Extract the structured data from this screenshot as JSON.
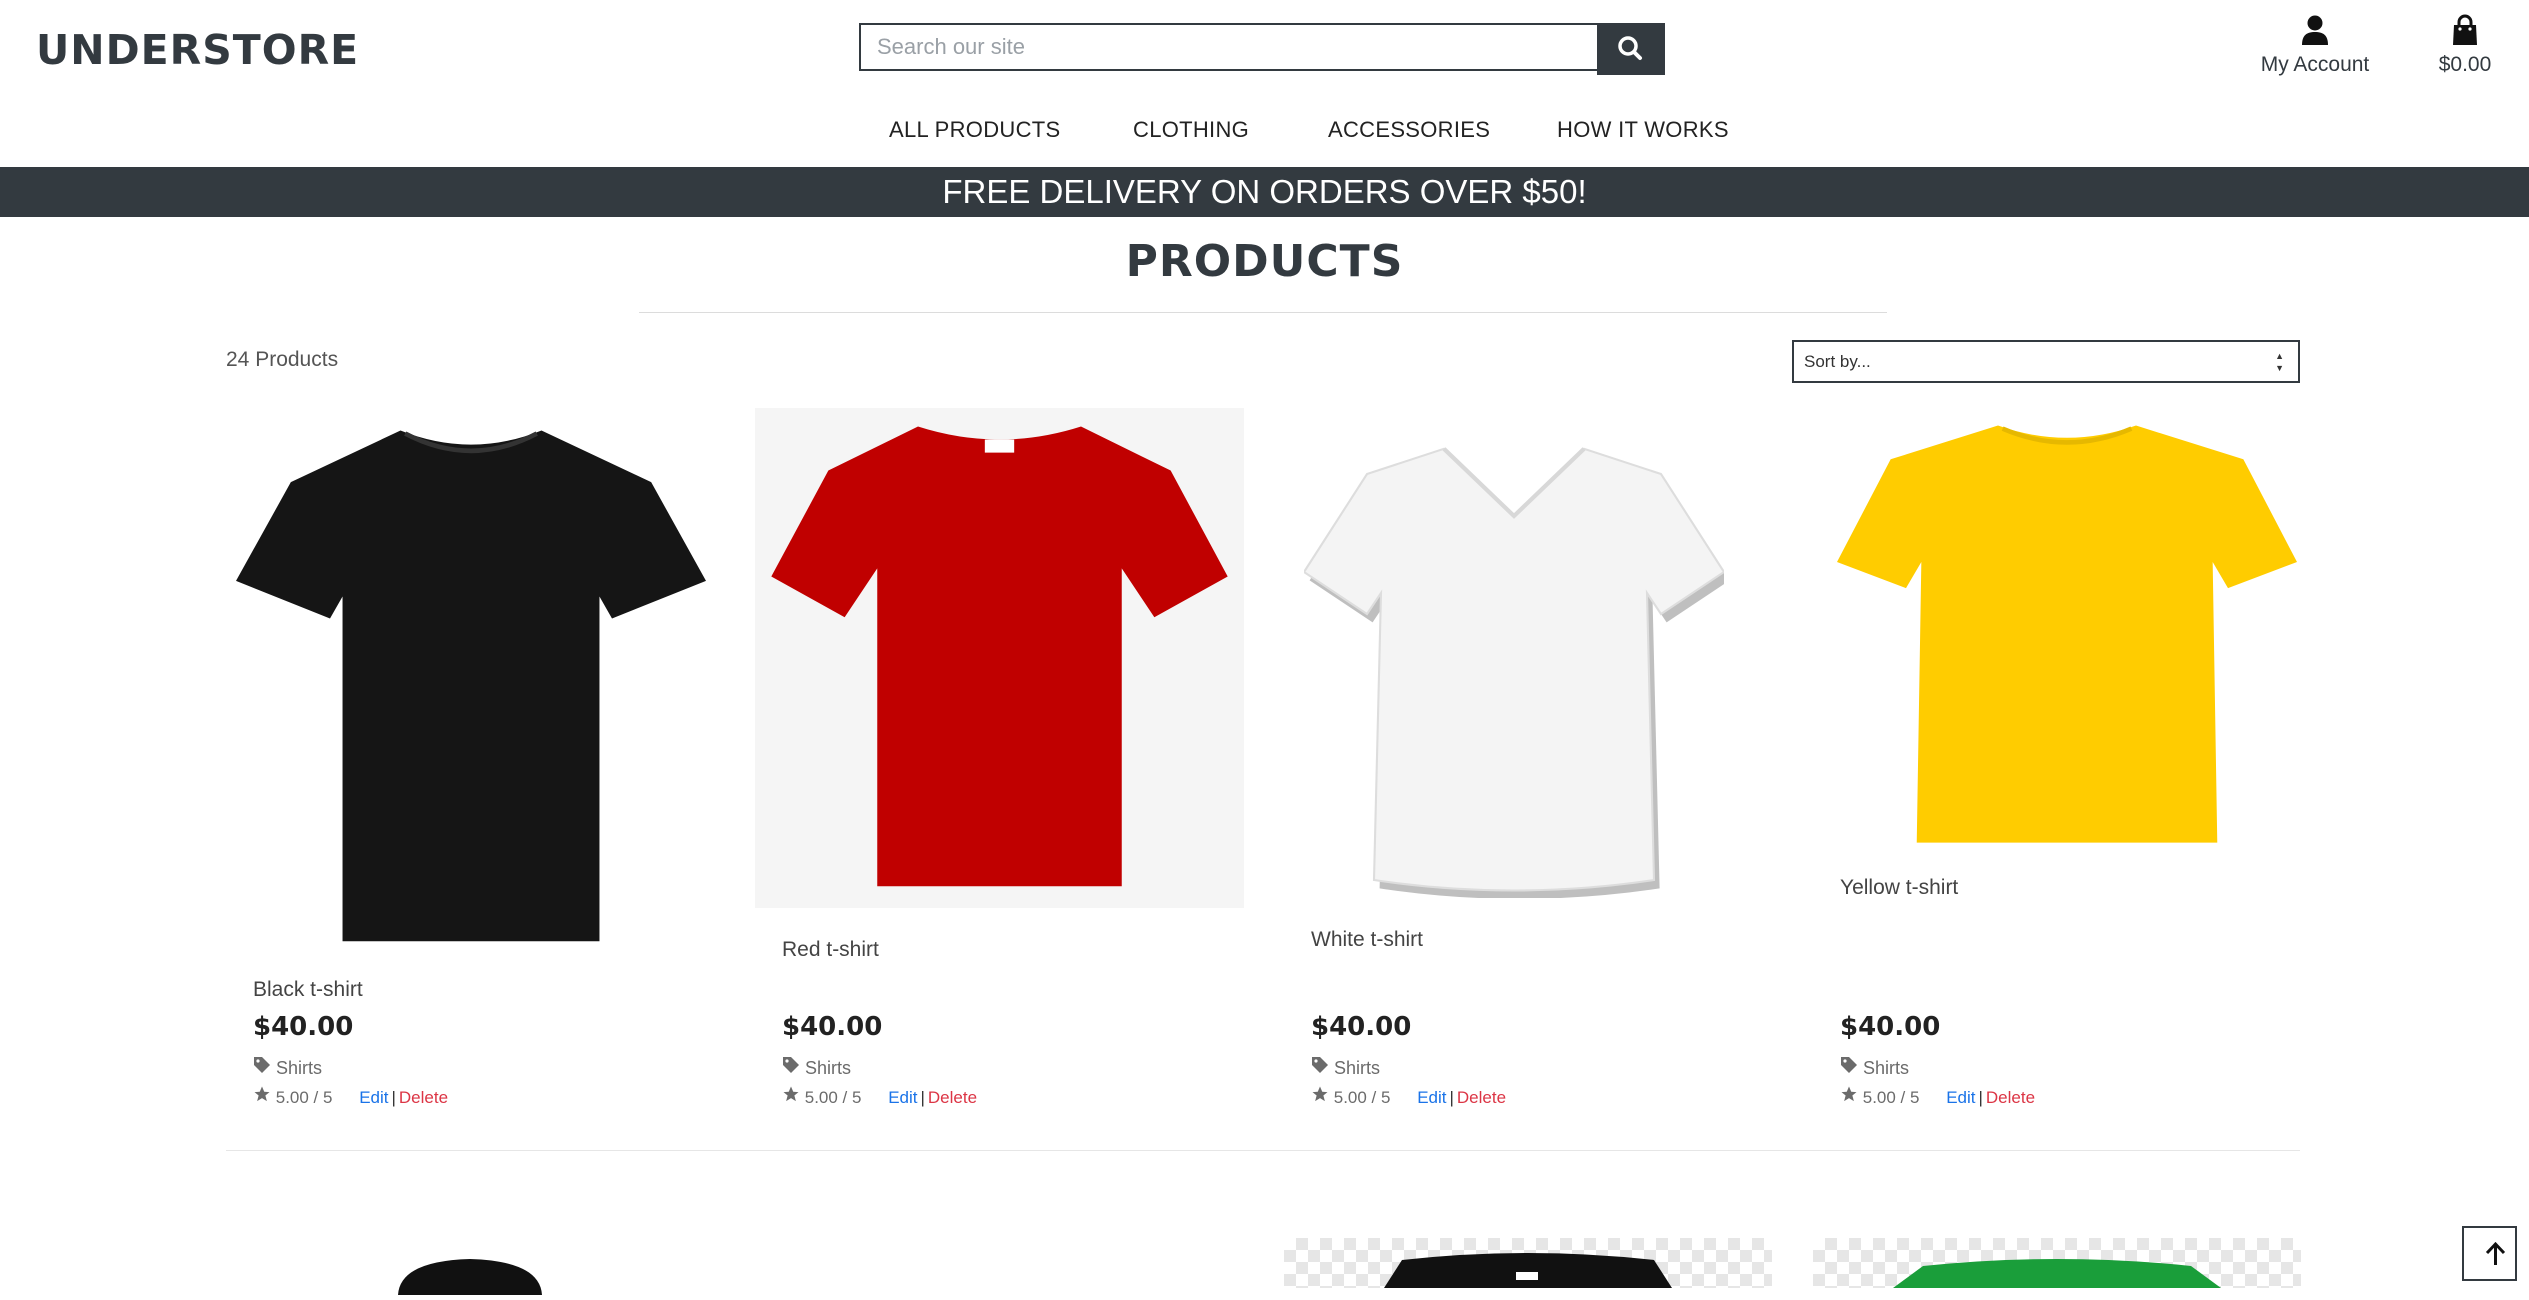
{
  "brand": "UNDERSTORE",
  "search": {
    "placeholder": "Search our site",
    "value": ""
  },
  "header": {
    "account_label": "My Account",
    "cart_total": "$0.00"
  },
  "nav": [
    "ALL PRODUCTS",
    "CLOTHING",
    "ACCESSORIES",
    "HOW IT WORKS"
  ],
  "promo": "FREE DELIVERY ON ORDERS OVER $50!",
  "page_title": "PRODUCTS",
  "product_count": "24 Products",
  "sort": {
    "selected": "Sort by..."
  },
  "actions": {
    "edit": "Edit",
    "separator": "|",
    "delete": "Delete"
  },
  "products": [
    {
      "name": "Black t-shirt",
      "price": "$40.00",
      "category": "Shirts",
      "rating": "5.00 / 5",
      "color": "#151515"
    },
    {
      "name": "Red t-shirt",
      "price": "$40.00",
      "category": "Shirts",
      "rating": "5.00 / 5",
      "color": "#c00000"
    },
    {
      "name": "White t-shirt",
      "price": "$40.00",
      "category": "Shirts",
      "rating": "5.00 / 5",
      "color": "#f4f4f4"
    },
    {
      "name": "Yellow t-shirt",
      "price": "$40.00",
      "category": "Shirts",
      "rating": "5.00 / 5",
      "color": "#ffcc00"
    }
  ],
  "next_row_colors": [
    "#111111",
    "#111111",
    "#1a9e3a"
  ],
  "icons": {
    "search": "search-icon",
    "account": "user-icon",
    "cart": "shopping-bag-icon",
    "category": "tag-icon",
    "rating": "star-icon",
    "back_to_top": "arrow-up-icon"
  }
}
